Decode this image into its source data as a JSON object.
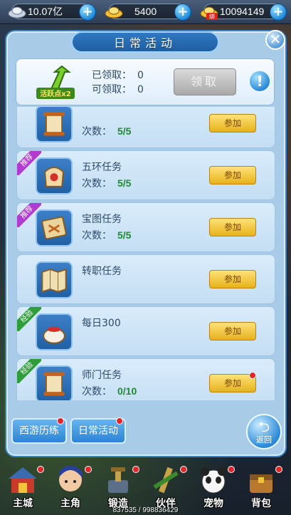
{
  "currency": {
    "silver": "10.07亿",
    "gold": "5400",
    "bound": "10094149",
    "bound_badge": "绑"
  },
  "panel": {
    "title": "日常活动",
    "close_symbol": "✕"
  },
  "reward": {
    "badge_text": "活跃点x2",
    "received_label": "已领取：",
    "received_value": "0",
    "claimable_label": "可领取：",
    "claimable_value": "0",
    "claim_button": "领取",
    "info_symbol": "!"
  },
  "activities": [
    {
      "name": "",
      "count_label": "次数：",
      "count": "5/5",
      "ribbon": "",
      "join_label": "参加",
      "icon": "scroll-icon",
      "badge": false
    },
    {
      "name": "五环任务",
      "count_label": "次数：",
      "count": "5/5",
      "ribbon": "推荐",
      "join_label": "参加",
      "icon": "bag-icon",
      "badge": false
    },
    {
      "name": "宝图任务",
      "count_label": "次数：",
      "count": "5/5",
      "ribbon": "推荐",
      "join_label": "参加",
      "icon": "treasure-map-icon",
      "badge": false
    },
    {
      "name": "转职任务",
      "count_label": "",
      "count": "",
      "ribbon": "",
      "join_label": "参加",
      "icon": "map-icon",
      "badge": false
    },
    {
      "name": "每日300",
      "count_label": "",
      "count": "",
      "ribbon": "经验",
      "join_label": "参加",
      "icon": "pot-icon",
      "badge": false
    },
    {
      "name": "师门任务",
      "count_label": "次数：",
      "count": "0/10",
      "ribbon": "经验",
      "join_label": "参加",
      "icon": "scroll-icon",
      "badge": true
    }
  ],
  "tabs": {
    "journey": "西游历练",
    "daily": "日常活动",
    "back": "返回"
  },
  "nav": [
    {
      "label": "主城",
      "icon": "city-icon"
    },
    {
      "label": "主角",
      "icon": "hero-icon"
    },
    {
      "label": "锻造",
      "icon": "forge-icon"
    },
    {
      "label": "伙伴",
      "icon": "partner-icon"
    },
    {
      "label": "宠物",
      "icon": "pet-icon"
    },
    {
      "label": "背包",
      "icon": "bag-icon"
    }
  ],
  "footer": "837535 / 998836429",
  "colors": {
    "panel_bg": "#a8cbe8",
    "title_blue": "#2f79c2",
    "join_gold": "#e7b21a",
    "count_green": "#1e8a33",
    "ribbon_purple": "#b23ad0",
    "ribbon_green": "#2f9e3a",
    "badge_red": "#e4252a"
  }
}
